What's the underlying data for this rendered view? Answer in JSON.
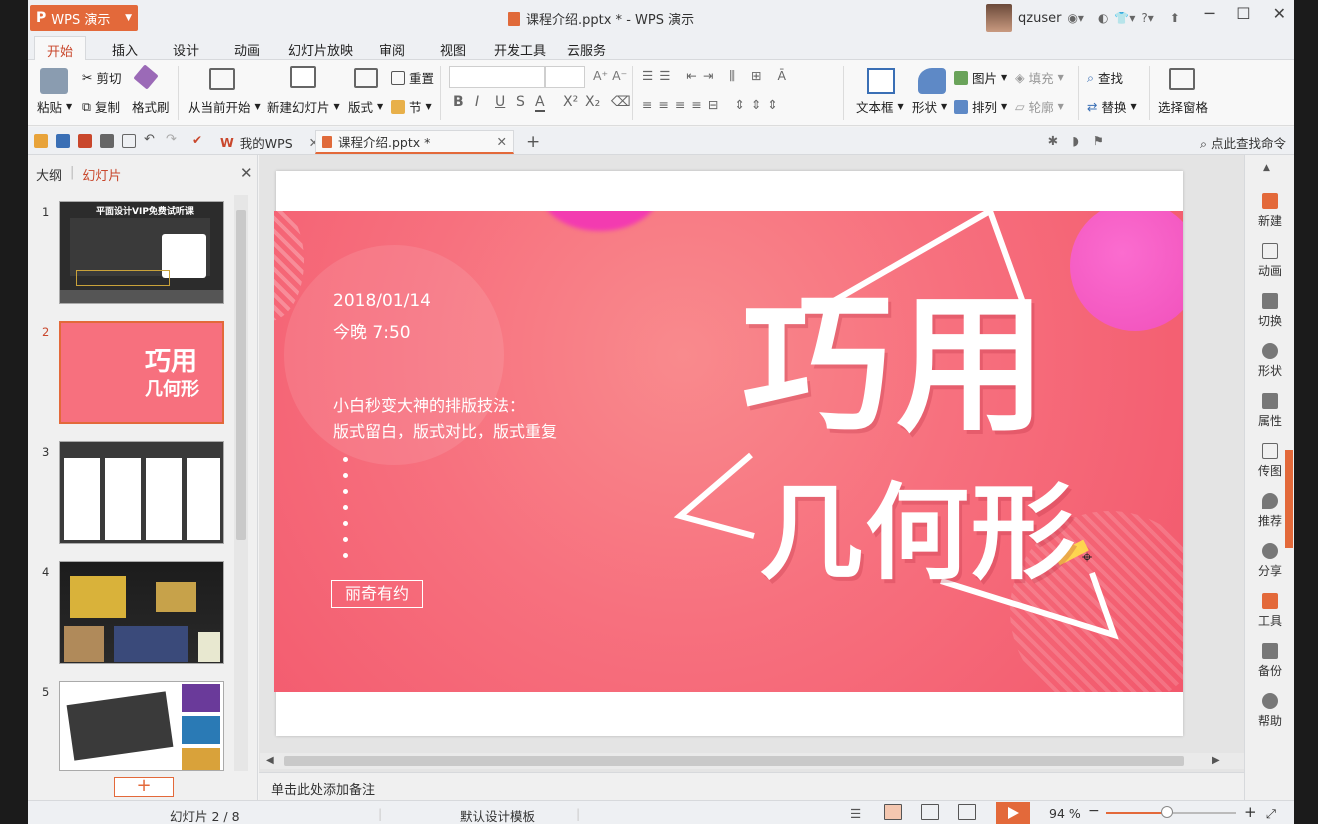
{
  "window": {
    "app_button": "WPS 演示",
    "app_logo": "P",
    "doc_title": "课程介绍.pptx * - WPS 演示",
    "username": "qzuser",
    "help_label": "?"
  },
  "menu": [
    "开始",
    "插入",
    "设计",
    "动画",
    "幻灯片放映",
    "审阅",
    "视图",
    "开发工具",
    "云服务"
  ],
  "ribbon": {
    "paste": "粘贴",
    "cut": "剪切",
    "copy": "复制",
    "format_painter": "格式刷",
    "from_current": "从当前开始",
    "new_slide": "新建幻灯片",
    "layout": "版式",
    "reset": "重置",
    "section": "节",
    "textbox": "文本框",
    "shape": "形状",
    "picture": "图片",
    "fill": "填充",
    "arrange": "排列",
    "outline": "轮廓",
    "find": "查找",
    "replace": "替换",
    "selection_pane": "选择窗格"
  },
  "tabs": {
    "my_wps": "我的WPS",
    "doc": "课程介绍.pptx *",
    "find_command": "点此查找命令"
  },
  "left_panel": {
    "tab_outline": "大纲",
    "tab_slides": "幻灯片",
    "selected": 2,
    "thumbnails": [
      "1",
      "2",
      "3",
      "4",
      "5"
    ],
    "thumb1_title": "平面设计VIP免费试听课",
    "thumb2_title": "巧用",
    "thumb2_sub": "几何形"
  },
  "slide": {
    "date": "2018/01/14",
    "time": "今晚 7:50",
    "subtitle1": "小白秒变大神的排版技法：",
    "subtitle2": "版式留白，版式对比，版式重复",
    "author": "丽奇有约",
    "title_line1": "巧用",
    "title_line2": "几何形",
    "colors": {
      "bg": "#f7707e",
      "accent": "#e3693a"
    }
  },
  "notes_placeholder": "单击此处添加备注",
  "right_bar": [
    "新建",
    "动画",
    "切换",
    "形状",
    "属性",
    "传图",
    "推荐",
    "分享",
    "工具",
    "备份",
    "帮助"
  ],
  "status": {
    "slide_counter": "幻灯片 2 / 8",
    "template": "默认设计模板",
    "zoom": "94 %",
    "zoom_level": 0.47
  }
}
